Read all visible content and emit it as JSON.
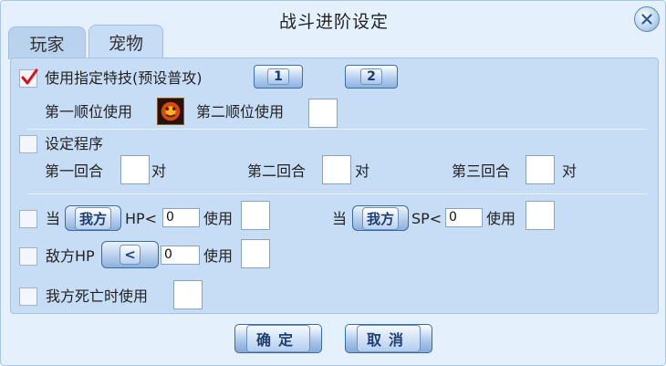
{
  "window": {
    "title": "战斗进阶设定",
    "close_icon": "close-icon"
  },
  "tabs": [
    {
      "label": "玩家"
    },
    {
      "label": "宠物",
      "active": true
    }
  ],
  "skill_section": {
    "checked": true,
    "label": "使用指定特技(预设普攻)",
    "buttons": [
      "1",
      "2"
    ],
    "first_priority_label": "第一顺位使用",
    "second_priority_label": "第二顺位使用"
  },
  "program_section": {
    "label": "设定程序",
    "rounds": [
      {
        "label": "第一回合",
        "suffix": "对"
      },
      {
        "label": "第二回合",
        "suffix": "对"
      },
      {
        "label": "第三回合",
        "suffix": "对"
      }
    ]
  },
  "conditions": {
    "hp": {
      "prefix": "当",
      "side": "我方",
      "stat": "HP<",
      "value": "0",
      "use": "使用"
    },
    "sp": {
      "prefix": "当",
      "side": "我方",
      "stat": "SP<",
      "value": "0",
      "use": "使用"
    },
    "enemy_hp": {
      "label": "敌方HP",
      "operator": "<",
      "value": "0",
      "use": "使用"
    },
    "ally_death": {
      "label": "我方死亡时使用"
    }
  },
  "footer": {
    "ok": "确定",
    "cancel": "取消"
  }
}
